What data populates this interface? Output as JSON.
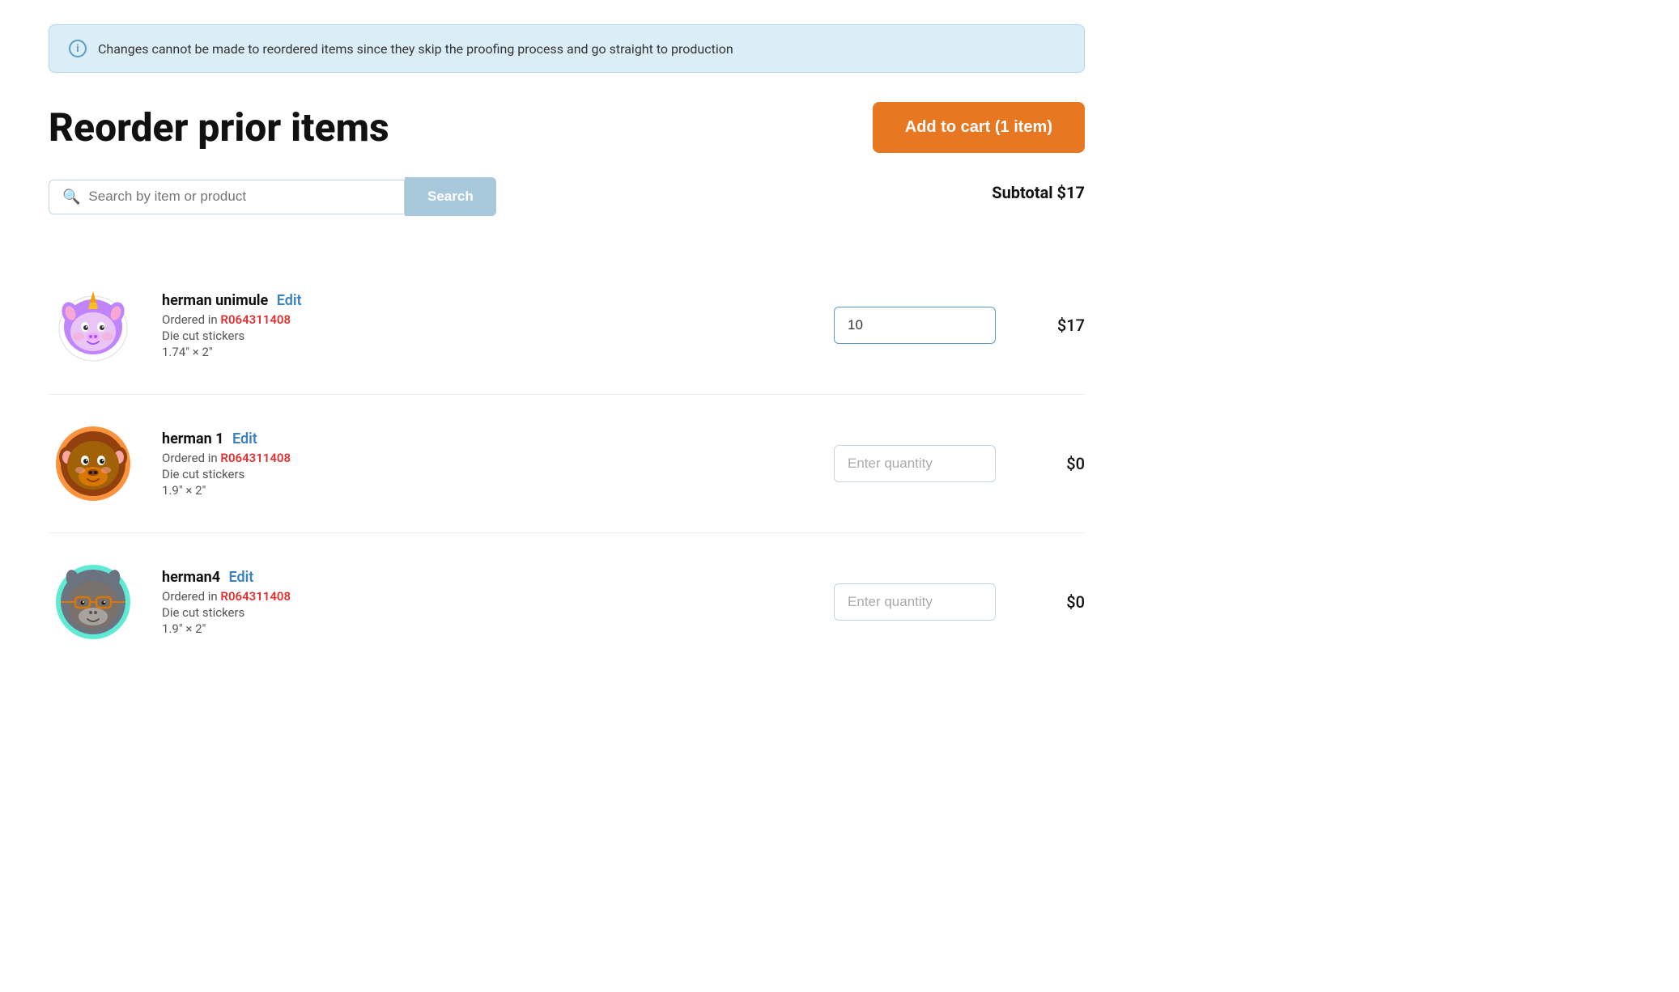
{
  "banner": {
    "icon_label": "i",
    "text": "Changes cannot be made to reordered items since they skip the proofing process and go straight to production"
  },
  "page": {
    "title": "Reorder prior items",
    "add_to_cart_label": "Add to cart (1 item)",
    "subtotal_label": "Subtotal $17"
  },
  "search": {
    "placeholder": "Search by item or product",
    "button_label": "Search"
  },
  "items": [
    {
      "id": "item-1",
      "name": "herman unimule",
      "edit_label": "Edit",
      "ordered_in_prefix": "Ordered in",
      "order_number": "R064311408",
      "product_type": "Die cut stickers",
      "size": "1.74″ × 2″",
      "quantity_value": "10",
      "quantity_placeholder": "",
      "price": "$17",
      "sticker_type": "unimule",
      "has_value": true
    },
    {
      "id": "item-2",
      "name": "herman 1",
      "edit_label": "Edit",
      "ordered_in_prefix": "Ordered in",
      "order_number": "R064311408",
      "product_type": "Die cut stickers",
      "size": "1.9″ × 2″",
      "quantity_value": "",
      "quantity_placeholder": "Enter quantity",
      "price": "$0",
      "sticker_type": "herman1",
      "has_value": false
    },
    {
      "id": "item-3",
      "name": "herman4",
      "edit_label": "Edit",
      "ordered_in_prefix": "Ordered in",
      "order_number": "R064311408",
      "product_type": "Die cut stickers",
      "size": "1.9″ × 2″",
      "quantity_value": "",
      "quantity_placeholder": "Enter quantity",
      "price": "$0",
      "sticker_type": "herman4",
      "has_value": false
    }
  ],
  "colors": {
    "accent_orange": "#e87722",
    "accent_blue": "#3b82c4",
    "accent_red": "#e03030",
    "banner_bg": "#dbeef8"
  }
}
